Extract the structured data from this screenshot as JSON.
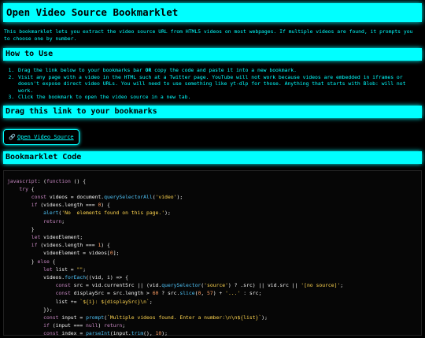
{
  "title": "Open Video Source Bookmarklet",
  "intro": "This bookmarklet lets you extract the video source URL from HTML5 videos on most webpages. If multiple videos are found, it prompts you to choose one by number.",
  "how_to": {
    "heading": "How to Use",
    "step1_before": "Drag the link below to your bookmarks bar ",
    "step1_or": "OR",
    "step1_after": " copy the code and paste it into a new bookmark.",
    "step2": "Visit any page with a video in the HTML such at a Twitter page. YouTube will not work because videos are embedded in iframes or doesn't expose direct video URLs. You will need to use something like yt-dlp for those. Anything that starts with Blob: will not work.",
    "step3": "Click the bookmark to open the video source in a new tab."
  },
  "drag": {
    "heading": "Drag this link to your bookmarks",
    "link_icon": "link-icon",
    "link_label": "Open Video Source"
  },
  "code": {
    "heading": "Bookmarklet Code",
    "lines": [
      "javascript: (function () {",
      "    try {",
      "        const videos = document.querySelectorAll('video');",
      "        if (videos.length === 0) {",
      "            alert('No  elements found on this page.');",
      "            return;",
      "        }",
      "        let videoElement;",
      "        if (videos.length === 1) {",
      "            videoElement = videos[0];",
      "        } else {",
      "            let list = \"\";",
      "            videos.forEach((vid, i) => {",
      "                const src = vid.currentSrc || (vid.querySelector('source') ? .src) || vid.src || '[no source]';",
      "                const displaySrc = src.length > 60 ? src.slice(0, 57) + '...' : src;",
      "                list += `${i}: ${displaySrc}\\n`;",
      "            });",
      "            const input = prompt(`Multiple videos found. Enter a number:\\n\\n${list}`);",
      "            if (input === null) return;",
      "            const index = parseInt(input.trim(), 10);"
    ]
  },
  "colors": {
    "background": "#000000",
    "accent": "#00ffff"
  }
}
